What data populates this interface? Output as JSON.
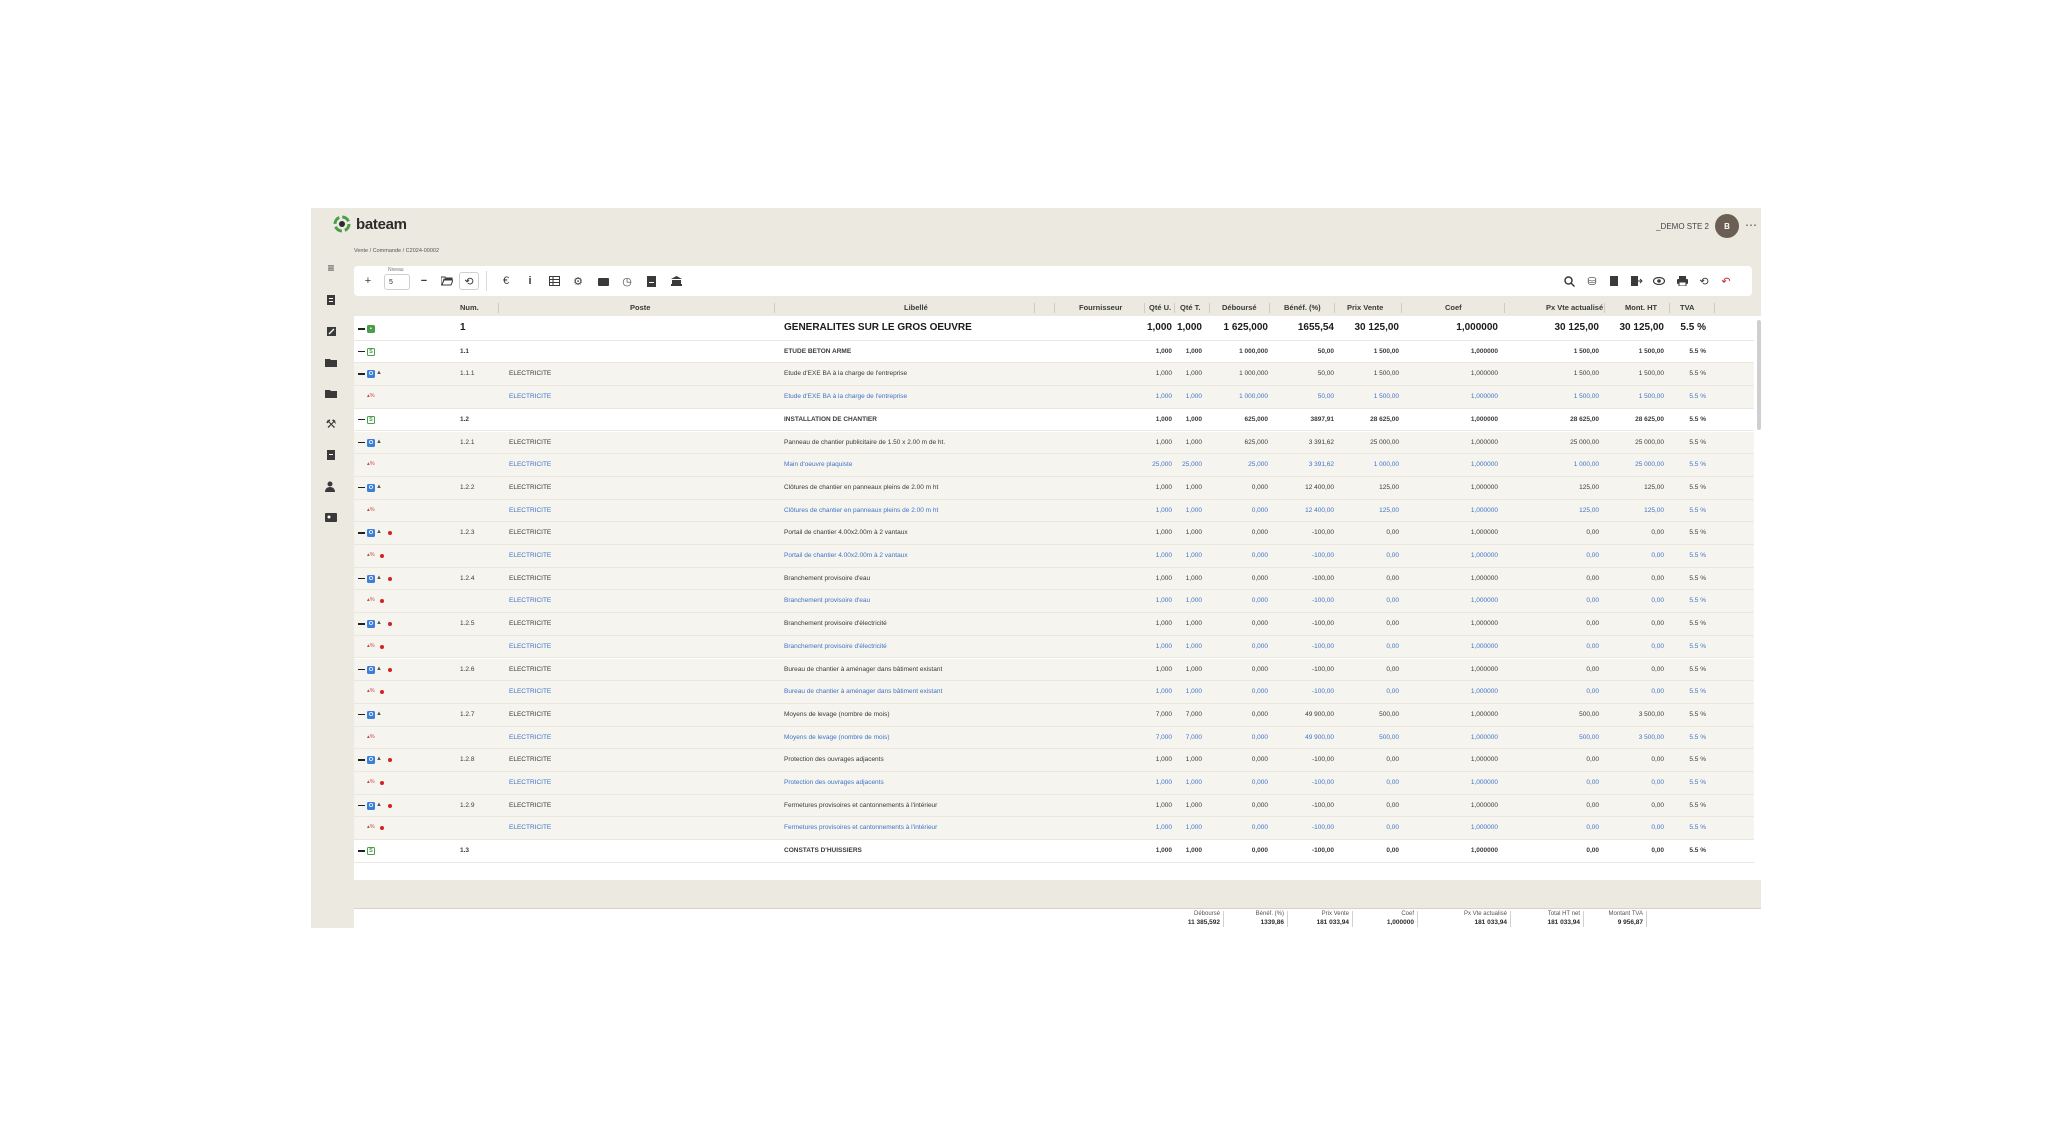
{
  "app": {
    "brand": "bateam",
    "company": "_DEMO STE 2",
    "avatar_initial": "B",
    "more": "⋯"
  },
  "breadcrumb": "Vente  /  Commande  /  C2024-00002",
  "toolbar": {
    "niveau_label": "Niveau",
    "niveau_value": "5"
  },
  "columns": [
    "Num.",
    "Poste",
    "Libellé",
    "Fournisseur",
    "Qté U.",
    "Qté T.",
    "Déboursé",
    "Bénéf. (%)",
    "Prix Vente",
    "Coef",
    "Px Vte actualisé",
    "Mont. HT",
    "TVA"
  ],
  "rows": [
    {
      "kind": "lvl0",
      "icons": "minus,green",
      "num": "1",
      "poste": "",
      "libelle": "GENERALITES SUR LE GROS OEUVRE",
      "qu": "1,000",
      "qt": "1,000",
      "debourse": "1 625,000",
      "benef": "1655,54",
      "prix": "30 125,00",
      "coef": "1,000000",
      "pxa": "30 125,00",
      "mht": "30 125,00",
      "tva": "5.5 %"
    },
    {
      "kind": "sec",
      "icons": "minus,dkgreen",
      "num": "1.1",
      "poste": "",
      "libelle": "ETUDE BETON ARME",
      "qu": "1,000",
      "qt": "1,000",
      "debourse": "1 000,000",
      "benef": "50,00",
      "prix": "1 500,00",
      "coef": "1,000000",
      "pxa": "1 500,00",
      "mht": "1 500,00",
      "tva": "5.5 %"
    },
    {
      "kind": "item",
      "icons": "minus,blue",
      "num": "1.1.1",
      "poste": "ELECTRICITE",
      "libelle": "Etude d'EXE BA à la charge de l'entreprise",
      "qu": "1,000",
      "qt": "1,000",
      "debourse": "1 000,000",
      "benef": "50,00",
      "prix": "1 500,00",
      "coef": "1,000000",
      "pxa": "1 500,00",
      "mht": "1 500,00",
      "tva": "5.5 %",
      "dot": false
    },
    {
      "kind": "blue",
      "icons": "sub",
      "num": "",
      "poste": "ELECTRICITE",
      "libelle": "Etude d'EXE BA à la charge de l'entreprise",
      "qu": "1,000",
      "qt": "1,000",
      "debourse": "1 000,000",
      "benef": "50,00",
      "prix": "1 500,00",
      "coef": "1,000000",
      "pxa": "1 500,00",
      "mht": "1 500,00",
      "tva": "5.5 %",
      "dot": false
    },
    {
      "kind": "sec",
      "icons": "minus,dkgreen",
      "num": "1.2",
      "poste": "",
      "libelle": "INSTALLATION DE CHANTIER",
      "qu": "1,000",
      "qt": "1,000",
      "debourse": "625,000",
      "benef": "3897,91",
      "prix": "28 625,00",
      "coef": "1,000000",
      "pxa": "28 625,00",
      "mht": "28 625,00",
      "tva": "5.5 %"
    },
    {
      "kind": "item",
      "icons": "minus,blue",
      "num": "1.2.1",
      "poste": "ELECTRICITE",
      "libelle": "Panneau de chantier publicitaire de 1.50 x 2.00 m de ht.",
      "qu": "1,000",
      "qt": "1,000",
      "debourse": "625,000",
      "benef": "3 391,62",
      "prix": "25 000,00",
      "coef": "1,000000",
      "pxa": "25 000,00",
      "mht": "25 000,00",
      "tva": "5.5 %",
      "dot": false
    },
    {
      "kind": "blue",
      "icons": "sub",
      "num": "",
      "poste": "ELECTRICITE",
      "libelle": "Main d'oeuvre plaquiste",
      "qu": "25,000",
      "qt": "25,000",
      "debourse": "25,000",
      "benef": "3 391,62",
      "prix": "1 000,00",
      "coef": "1,000000",
      "pxa": "1 000,00",
      "mht": "25 000,00",
      "tva": "5.5 %",
      "dot": false
    },
    {
      "kind": "item",
      "icons": "minus,blue",
      "num": "1.2.2",
      "poste": "ELECTRICITE",
      "libelle": "Clôtures de chantier en panneaux pleins de 2.00 m ht",
      "qu": "1,000",
      "qt": "1,000",
      "debourse": "0,000",
      "benef": "12 400,00",
      "prix": "125,00",
      "coef": "1,000000",
      "pxa": "125,00",
      "mht": "125,00",
      "tva": "5.5 %",
      "dot": false
    },
    {
      "kind": "blue",
      "icons": "sub",
      "num": "",
      "poste": "ELECTRICITE",
      "libelle": "Clôtures de chantier en panneaux pleins de 2.00 m ht",
      "qu": "1,000",
      "qt": "1,000",
      "debourse": "0,000",
      "benef": "12 400,00",
      "prix": "125,00",
      "coef": "1,000000",
      "pxa": "125,00",
      "mht": "125,00",
      "tva": "5.5 %",
      "dot": false
    },
    {
      "kind": "item",
      "icons": "minus,blue",
      "num": "1.2.3",
      "poste": "ELECTRICITE",
      "libelle": "Portail de chantier 4.00x2.00m à 2 vantaux",
      "qu": "1,000",
      "qt": "1,000",
      "debourse": "0,000",
      "benef": "-100,00",
      "prix": "0,00",
      "coef": "1,000000",
      "pxa": "0,00",
      "mht": "0,00",
      "tva": "5.5 %",
      "dot": true
    },
    {
      "kind": "blue",
      "icons": "sub",
      "num": "",
      "poste": "ELECTRICITE",
      "libelle": "Portail de chantier 4.00x2.00m à 2 vantaux",
      "qu": "1,000",
      "qt": "1,000",
      "debourse": "0,000",
      "benef": "-100,00",
      "prix": "0,00",
      "coef": "1,000000",
      "pxa": "0,00",
      "mht": "0,00",
      "tva": "5.5 %",
      "dot": true
    },
    {
      "kind": "item",
      "icons": "minus,blue",
      "num": "1.2.4",
      "poste": "ELECTRICITE",
      "libelle": "Branchement provisoire d'eau",
      "qu": "1,000",
      "qt": "1,000",
      "debourse": "0,000",
      "benef": "-100,00",
      "prix": "0,00",
      "coef": "1,000000",
      "pxa": "0,00",
      "mht": "0,00",
      "tva": "5.5 %",
      "dot": true
    },
    {
      "kind": "blue",
      "icons": "sub",
      "num": "",
      "poste": "ELECTRICITE",
      "libelle": "Branchement provisoire d'eau",
      "qu": "1,000",
      "qt": "1,000",
      "debourse": "0,000",
      "benef": "-100,00",
      "prix": "0,00",
      "coef": "1,000000",
      "pxa": "0,00",
      "mht": "0,00",
      "tva": "5.5 %",
      "dot": true
    },
    {
      "kind": "item",
      "icons": "minus,blue",
      "num": "1.2.5",
      "poste": "ELECTRICITE",
      "libelle": "Branchement provisoire d'électricité",
      "qu": "1,000",
      "qt": "1,000",
      "debourse": "0,000",
      "benef": "-100,00",
      "prix": "0,00",
      "coef": "1,000000",
      "pxa": "0,00",
      "mht": "0,00",
      "tva": "5.5 %",
      "dot": true
    },
    {
      "kind": "blue",
      "icons": "sub",
      "num": "",
      "poste": "ELECTRICITE",
      "libelle": "Branchement provisoire d'électricité",
      "qu": "1,000",
      "qt": "1,000",
      "debourse": "0,000",
      "benef": "-100,00",
      "prix": "0,00",
      "coef": "1,000000",
      "pxa": "0,00",
      "mht": "0,00",
      "tva": "5.5 %",
      "dot": true
    },
    {
      "kind": "item",
      "icons": "minus,blue",
      "num": "1.2.6",
      "poste": "ELECTRICITE",
      "libelle": "Bureau de chantier à aménager dans bâtiment existant",
      "qu": "1,000",
      "qt": "1,000",
      "debourse": "0,000",
      "benef": "-100,00",
      "prix": "0,00",
      "coef": "1,000000",
      "pxa": "0,00",
      "mht": "0,00",
      "tva": "5.5 %",
      "dot": true
    },
    {
      "kind": "blue",
      "icons": "sub",
      "num": "",
      "poste": "ELECTRICITE",
      "libelle": "Bureau de chantier à aménager dans bâtiment existant",
      "qu": "1,000",
      "qt": "1,000",
      "debourse": "0,000",
      "benef": "-100,00",
      "prix": "0,00",
      "coef": "1,000000",
      "pxa": "0,00",
      "mht": "0,00",
      "tva": "5.5 %",
      "dot": true
    },
    {
      "kind": "item",
      "icons": "minus,blue",
      "num": "1.2.7",
      "poste": "ELECTRICITE",
      "libelle": "Moyens de levage (nombre de mois)",
      "qu": "7,000",
      "qt": "7,000",
      "debourse": "0,000",
      "benef": "49 900,00",
      "prix": "500,00",
      "coef": "1,000000",
      "pxa": "500,00",
      "mht": "3 500,00",
      "tva": "5.5 %",
      "dot": false
    },
    {
      "kind": "blue",
      "icons": "sub",
      "num": "",
      "poste": "ELECTRICITE",
      "libelle": "Moyens de levage (nombre de mois)",
      "qu": "7,000",
      "qt": "7,000",
      "debourse": "0,000",
      "benef": "49 900,00",
      "prix": "500,00",
      "coef": "1,000000",
      "pxa": "500,00",
      "mht": "3 500,00",
      "tva": "5.5 %",
      "dot": false
    },
    {
      "kind": "item",
      "icons": "minus,blue",
      "num": "1.2.8",
      "poste": "ELECTRICITE",
      "libelle": "Protection des ouvrages adjacents",
      "qu": "1,000",
      "qt": "1,000",
      "debourse": "0,000",
      "benef": "-100,00",
      "prix": "0,00",
      "coef": "1,000000",
      "pxa": "0,00",
      "mht": "0,00",
      "tva": "5.5 %",
      "dot": true
    },
    {
      "kind": "blue",
      "icons": "sub",
      "num": "",
      "poste": "ELECTRICITE",
      "libelle": "Protection des ouvrages adjacents",
      "qu": "1,000",
      "qt": "1,000",
      "debourse": "0,000",
      "benef": "-100,00",
      "prix": "0,00",
      "coef": "1,000000",
      "pxa": "0,00",
      "mht": "0,00",
      "tva": "5.5 %",
      "dot": true
    },
    {
      "kind": "item",
      "icons": "minus,blue",
      "num": "1.2.9",
      "poste": "ELECTRICITE",
      "libelle": "Fermetures provisoires et cantonnements à l'intérieur",
      "qu": "1,000",
      "qt": "1,000",
      "debourse": "0,000",
      "benef": "-100,00",
      "prix": "0,00",
      "coef": "1,000000",
      "pxa": "0,00",
      "mht": "0,00",
      "tva": "5.5 %",
      "dot": true
    },
    {
      "kind": "blue",
      "icons": "sub",
      "num": "",
      "poste": "ELECTRICITE",
      "libelle": "Fermetures provisoires et cantonnements à l'intérieur",
      "qu": "1,000",
      "qt": "1,000",
      "debourse": "0,000",
      "benef": "-100,00",
      "prix": "0,00",
      "coef": "1,000000",
      "pxa": "0,00",
      "mht": "0,00",
      "tva": "5.5 %",
      "dot": true
    },
    {
      "kind": "sec",
      "icons": "minus,dkgreen",
      "num": "1.3",
      "poste": "",
      "libelle": "CONSTATS D'HUISSIERS",
      "qu": "1,000",
      "qt": "1,000",
      "debourse": "0,000",
      "benef": "-100,00",
      "prix": "0,00",
      "coef": "1,000000",
      "pxa": "0,00",
      "mht": "0,00",
      "tva": "5.5 %"
    }
  ],
  "footer": [
    {
      "label": "Déboursé",
      "value": "11 385,592"
    },
    {
      "label": "Bénéf. (%)",
      "value": "1339,86"
    },
    {
      "label": "Prix Vente",
      "value": "181 033,94"
    },
    {
      "label": "Coef",
      "value": "1,000000"
    },
    {
      "label": "Px Vte actualisé",
      "value": "181 033,94"
    },
    {
      "label": "Total HT net",
      "value": "181 033,94"
    },
    {
      "label": "Montant TVA",
      "value": "9 956,87"
    }
  ],
  "colors": {
    "accent_blue": "#3f74c8",
    "green": "#4a9e4a",
    "red_dot": "#d32222",
    "bg": "#ece9e1"
  }
}
